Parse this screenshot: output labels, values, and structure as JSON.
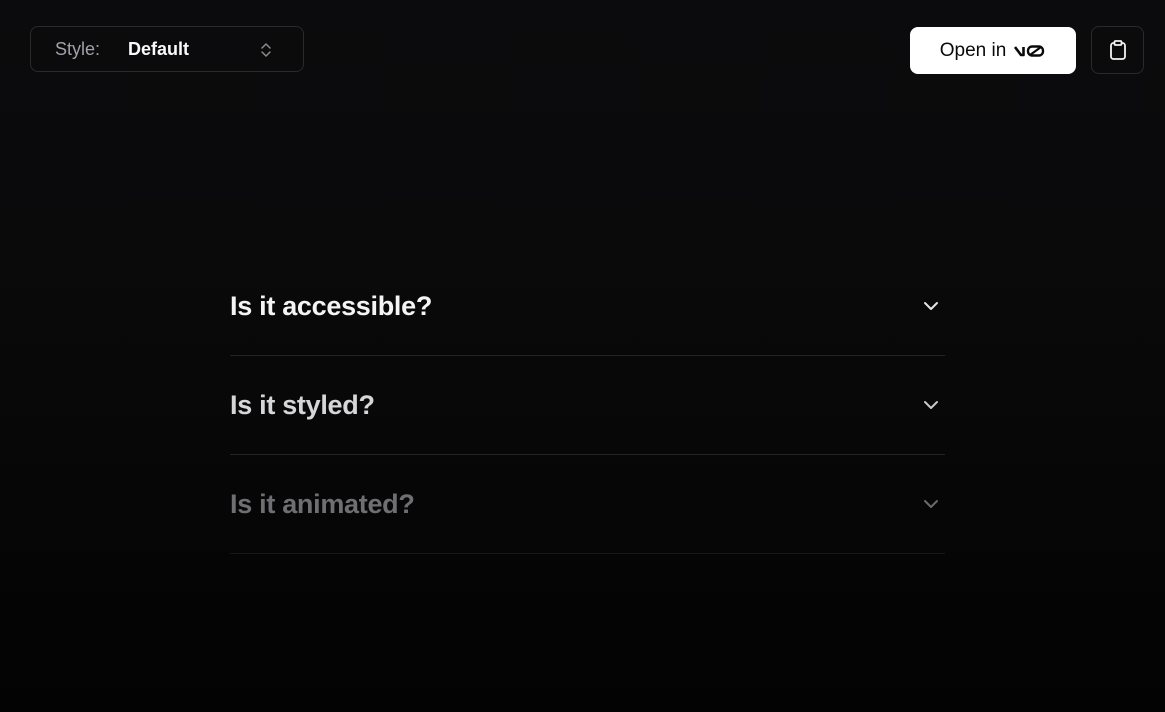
{
  "style_select": {
    "label": "Style:",
    "value": "Default"
  },
  "open_button": {
    "label": "Open in"
  },
  "accordion": {
    "items": [
      {
        "title": "Is it accessible?"
      },
      {
        "title": "Is it styled?"
      },
      {
        "title": "Is it animated?"
      }
    ]
  },
  "colors": {
    "background": "#0a0a0b",
    "border": "#2a2a2d",
    "button_bg": "#ffffff",
    "text": "#fafafa"
  },
  "icons": [
    "chevrons-up-down-icon",
    "v0-logo-icon",
    "clipboard-icon",
    "chevron-down-icon"
  ]
}
